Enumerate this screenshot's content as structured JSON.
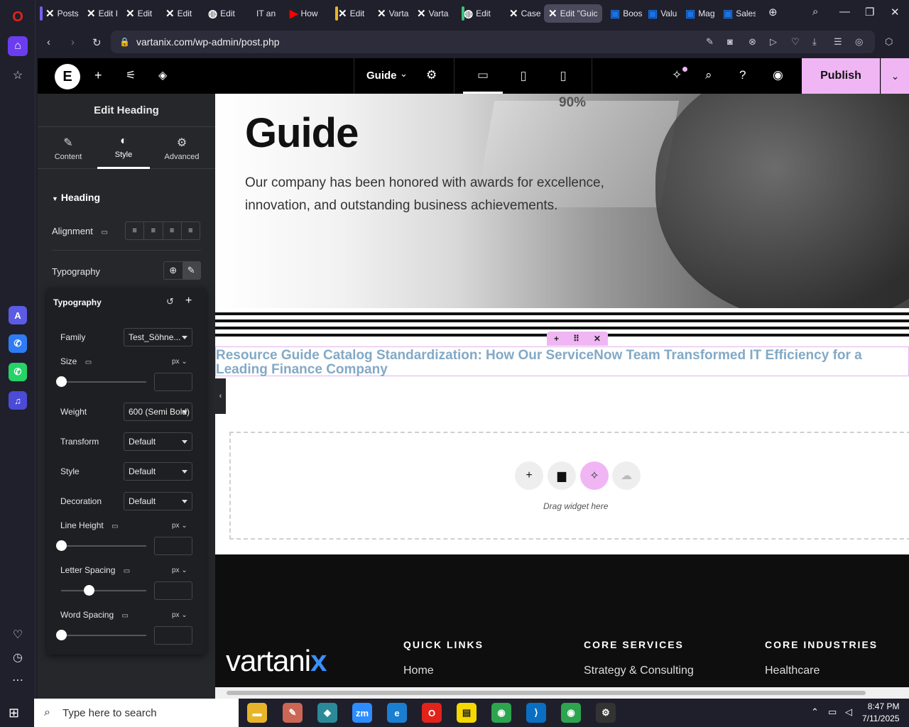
{
  "browser": {
    "tabs": [
      {
        "label": "Posts",
        "type": "x"
      },
      {
        "label": "Edit I",
        "type": "x"
      },
      {
        "label": "Edit",
        "type": "x"
      },
      {
        "label": "Edit",
        "type": "x"
      },
      {
        "label": "Edit",
        "type": "wp"
      },
      {
        "label": "IT an",
        "type": "none"
      },
      {
        "label": "How",
        "type": "yt"
      },
      {
        "label": "Edit",
        "type": "x"
      },
      {
        "label": "Varta",
        "type": "x"
      },
      {
        "label": "Varta",
        "type": "x"
      },
      {
        "label": "Edit",
        "type": "wp"
      },
      {
        "label": "Case",
        "type": "x"
      },
      {
        "label": "Edit \"Guic",
        "type": "x"
      },
      {
        "label": "Boos",
        "type": "ms"
      },
      {
        "label": "Valu",
        "type": "ms"
      },
      {
        "label": "Mag",
        "type": "ms"
      },
      {
        "label": "Sales",
        "type": "ms"
      }
    ],
    "url": "vartanix.com/wp-admin/post.php"
  },
  "editor": {
    "page_name": "Guide",
    "publish_label": "Publish"
  },
  "panel": {
    "title": "Edit Heading",
    "tabs": [
      "Content",
      "Style",
      "Advanced"
    ],
    "section": "Heading",
    "alignment_label": "Alignment",
    "typography_label": "Typography",
    "popup": {
      "title": "Typography",
      "family_label": "Family",
      "family_value": "Test_Söhne...",
      "size_label": "Size",
      "size_unit": "px",
      "weight_label": "Weight",
      "weight_value": "600 (Semi Bold)",
      "transform_label": "Transform",
      "transform_value": "Default",
      "style_label": "Style",
      "style_value": "Default",
      "decoration_label": "Decoration",
      "decoration_value": "Default",
      "line_height_label": "Line Height",
      "line_height_unit": "px",
      "letter_spacing_label": "Letter Spacing",
      "letter_spacing_unit": "px",
      "word_spacing_label": "Word Spacing",
      "word_spacing_unit": "px"
    }
  },
  "canvas": {
    "hero_title": "Guide",
    "hero_text": "Our company has been honored with awards for excellence, innovation, and outstanding business achievements.",
    "hero_badge": "90%",
    "heading_text": "Resource Guide Catalog Standardization: How Our ServiceNow Team Transformed IT Efficiency for a Leading Finance Company",
    "drag_text": "Drag widget here",
    "footer": {
      "logo_text": "vartani",
      "logo_accent": "x",
      "columns": [
        {
          "title": "QUICK LINKS",
          "link": "Home"
        },
        {
          "title": "CORE SERVICES",
          "link": "Strategy & Consulting"
        },
        {
          "title": "CORE INDUSTRIES",
          "link": "Healthcare"
        }
      ]
    }
  },
  "taskbar": {
    "search_placeholder": "Type here to search",
    "time": "8:47 PM",
    "date": "7/11/2025"
  },
  "colors": {
    "accent_pink": "#f0b6f4",
    "heading_blue": "#83a9c6",
    "opera_red": "#e2231a"
  }
}
